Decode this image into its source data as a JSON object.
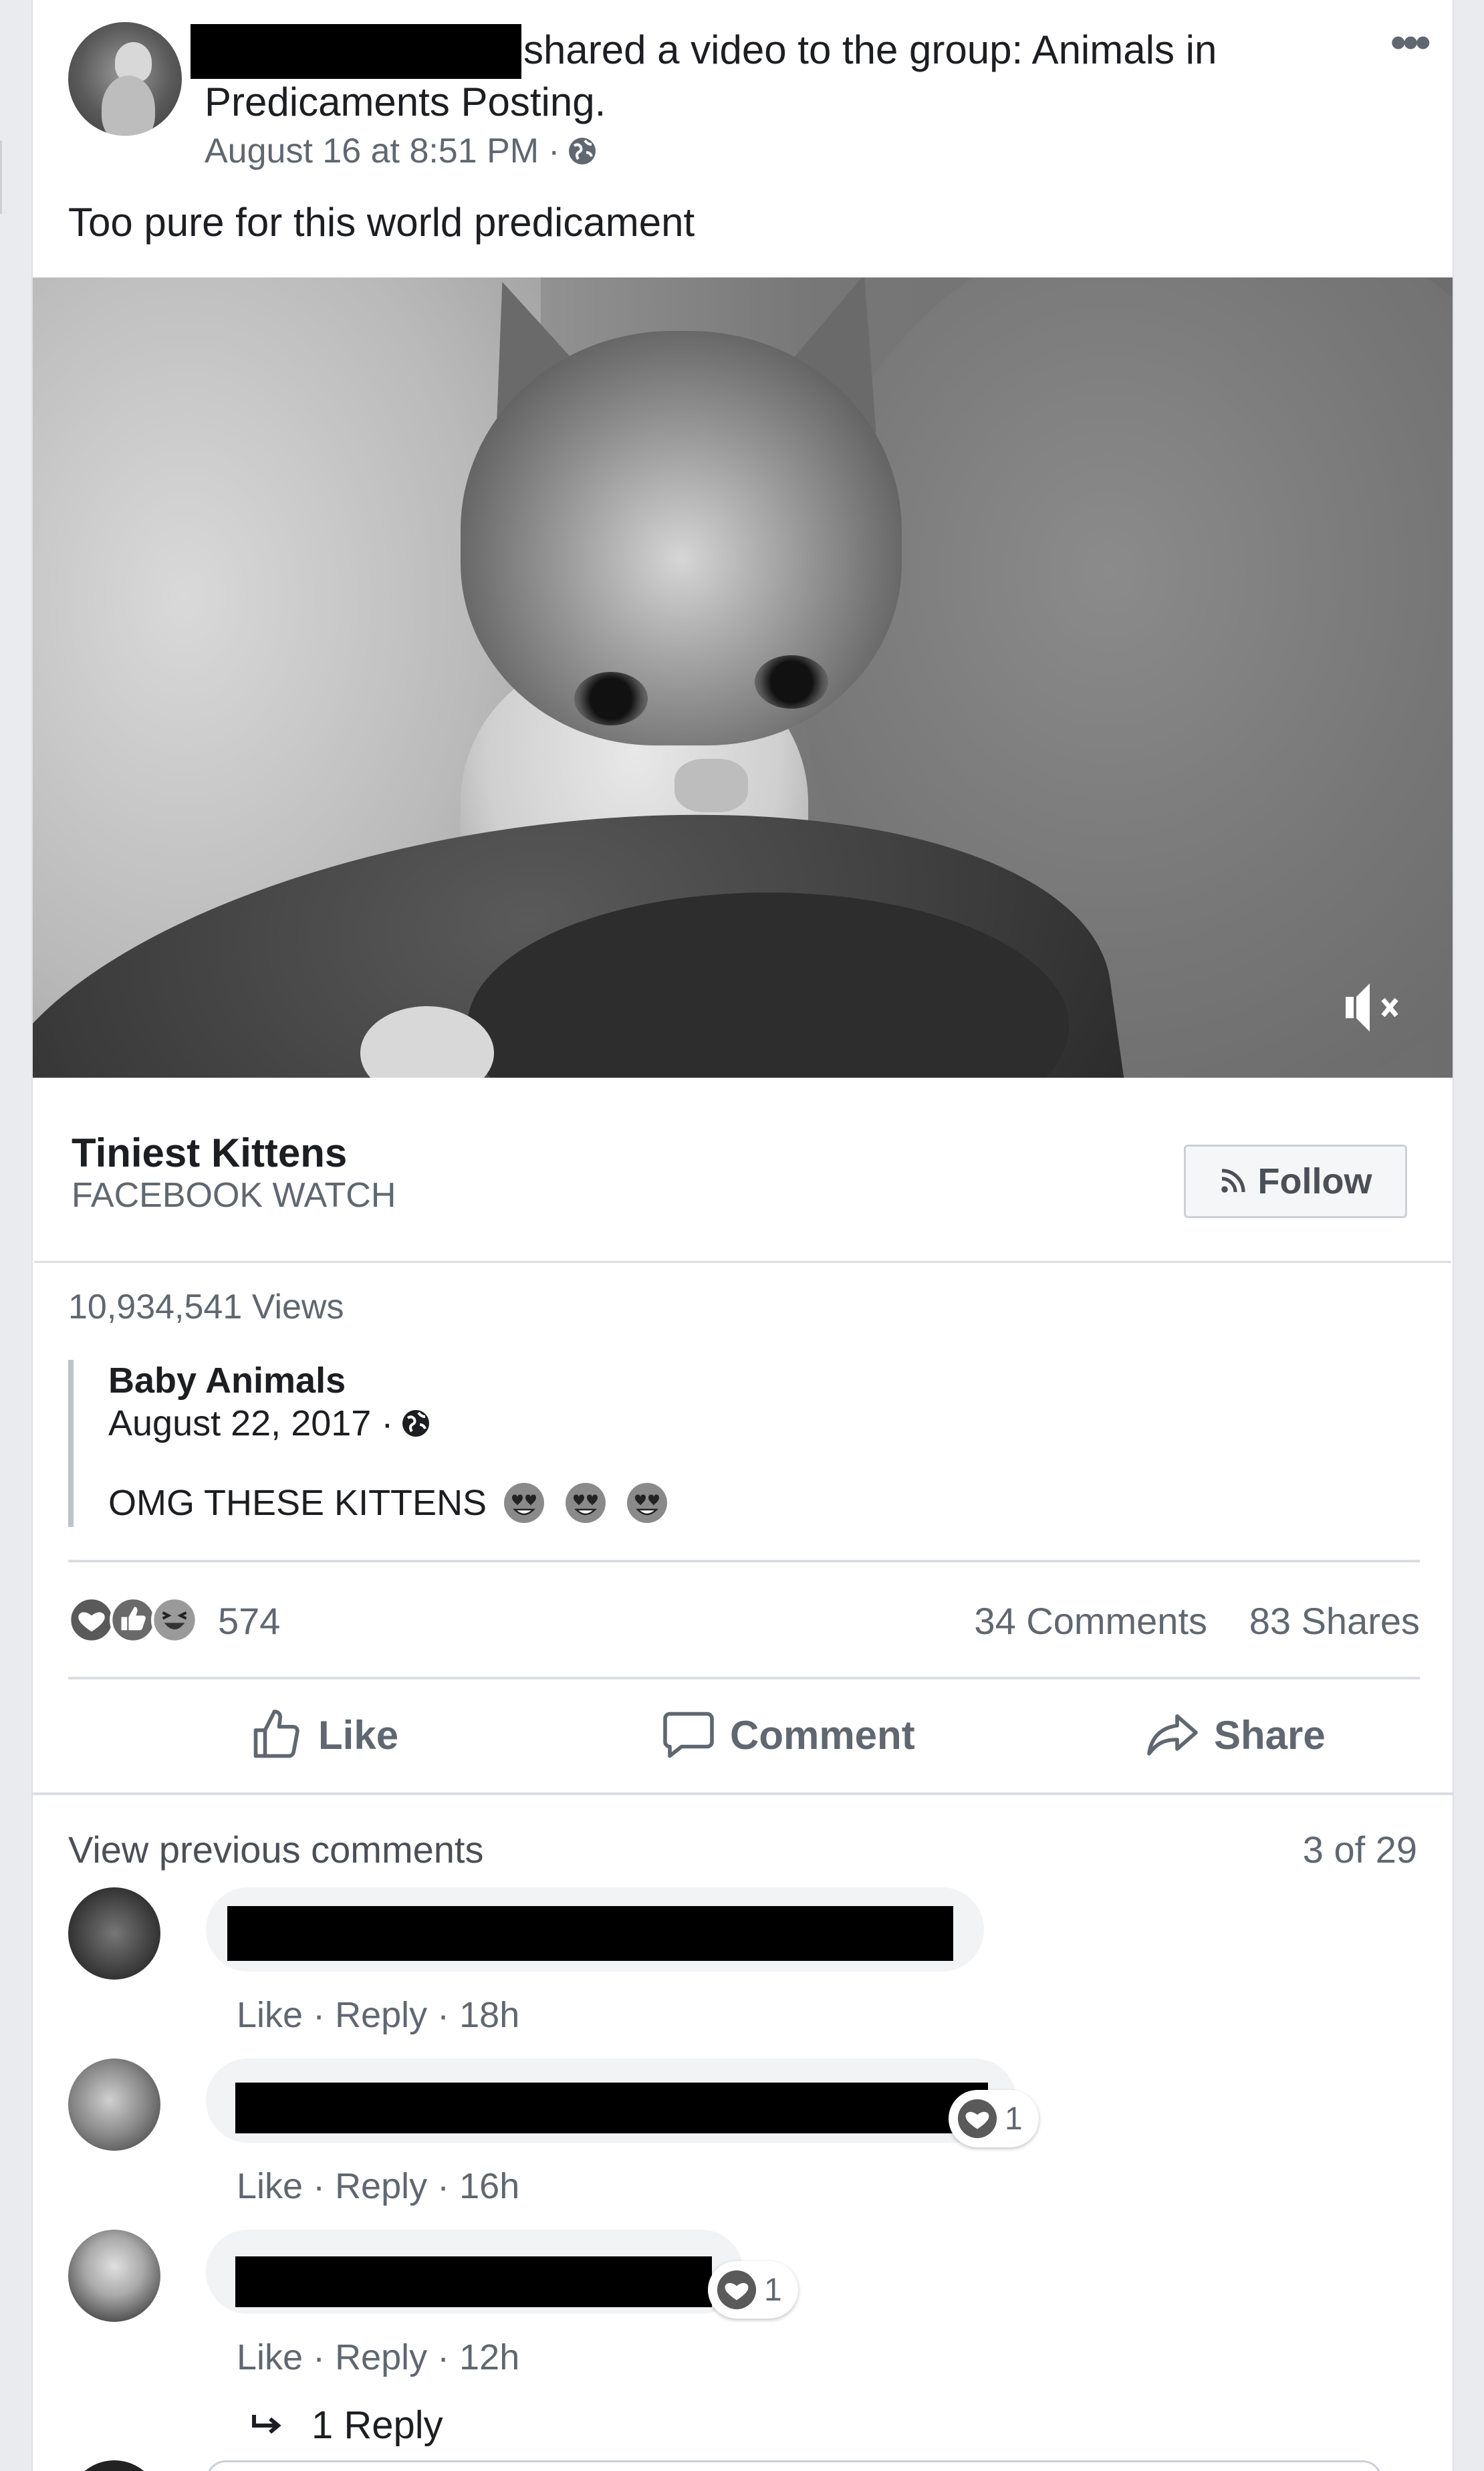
{
  "post": {
    "header_text": "shared a video to the group: Animals in",
    "header_text_line2": "Predicaments Posting.",
    "timestamp": "August 16 at 8:51 PM",
    "meta_separator": "·",
    "privacy_icon": "globe-icon",
    "more_icon": "more-options-icon",
    "body_text": "Too pure for this world predicament"
  },
  "video": {
    "mute_icon": "muted-speaker-icon"
  },
  "attachment": {
    "title": "Tiniest Kittens",
    "subtitle": "FACEBOOK WATCH",
    "follow_label": "Follow",
    "follow_icon": "rss-icon"
  },
  "stats": {
    "views": "10,934,541 Views"
  },
  "original_post": {
    "author": "Baby Animals",
    "date": "August 22, 2017 ·",
    "text": "OMG THESE KITTENS",
    "emojis": [
      "heart-eyes-emoji",
      "heart-eyes-emoji",
      "heart-eyes-emoji"
    ]
  },
  "reactions": {
    "icons": [
      "love-reaction-icon",
      "like-reaction-icon",
      "haha-reaction-icon"
    ],
    "count": "574",
    "comments": "34 Comments",
    "shares": "83 Shares"
  },
  "actions": {
    "like": "Like",
    "comment": "Comment",
    "share": "Share"
  },
  "comments_section": {
    "view_previous": "View previous comments",
    "pager": "3 of 29",
    "items": [
      {
        "like": "Like",
        "reply": "Reply",
        "time": "18h",
        "reaction_count": ""
      },
      {
        "like": "Like",
        "reply": "Reply",
        "time": "16h",
        "reaction_count": "1"
      },
      {
        "like": "Like",
        "reply": "Reply",
        "time": "12h",
        "reaction_count": "1"
      }
    ],
    "replies_label": "1 Reply",
    "reply_icon": "reply-arrow-icon"
  },
  "colors": {
    "text_primary": "#1c1e21",
    "text_secondary": "#606770",
    "bubble_bg": "#f2f3f5",
    "divider": "#dadde1"
  }
}
